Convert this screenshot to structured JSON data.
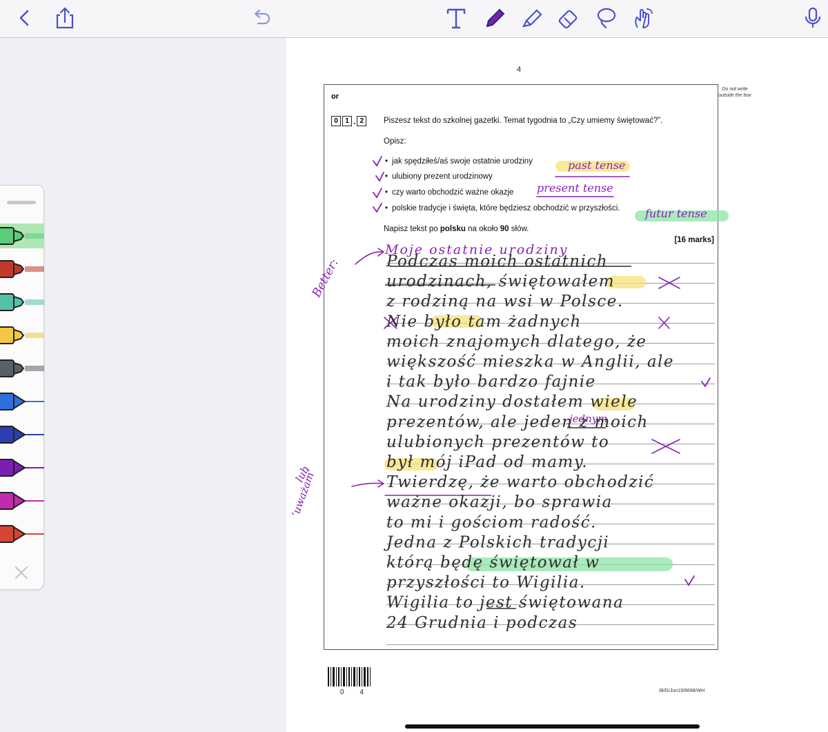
{
  "toolbar": {
    "back": "back-chevron-icon",
    "share": "share-icon",
    "undo": "undo-icon",
    "tools": [
      "text-tool-icon",
      "pen-tool-icon",
      "highlighter-tool-icon",
      "eraser-tool-icon",
      "lasso-tool-icon",
      "hand-touch-icon"
    ],
    "mic": "microphone-icon",
    "accent_color": "#4a4fd1"
  },
  "palette": {
    "selected_index": 0,
    "highlighters": [
      {
        "color": "#5ccb7a",
        "style": "highlighter",
        "selected": true
      },
      {
        "color": "#c0392b",
        "style": "highlighter"
      },
      {
        "color": "#55c0a8",
        "style": "highlighter"
      },
      {
        "color": "#f2c744",
        "style": "highlighter"
      },
      {
        "color": "#5b6066",
        "style": "highlighter"
      },
      {
        "color": "#2f6fdc",
        "style": "pen"
      },
      {
        "color": "#2b3fb0",
        "style": "pen"
      },
      {
        "color": "#7a1fb0",
        "style": "pen"
      },
      {
        "color": "#c22bb0",
        "style": "pen"
      },
      {
        "color": "#d64530",
        "style": "pen"
      }
    ]
  },
  "page": {
    "page_number": "4",
    "margin_note": "Do not write outside the box",
    "or_label": "or",
    "question_number": [
      "0",
      "1",
      "2"
    ],
    "question_text": "Piszesz tekst do szkolnej gazetki.  Temat tygodnia to „Czy umiemy świętować?”.",
    "opisz": "Opisz:",
    "bullets": [
      "jak spędziłeś/aś swoje ostatnie urodziny",
      "ulubiony prezent urodzinowy",
      "czy warto obchodzić ważne okazje",
      "polskie tradycje i święta, które będziesz obchodzić w przyszłości."
    ],
    "instruction_pre": "Napisz tekst po ",
    "instruction_bold1": "polsku",
    "instruction_mid": " na około ",
    "instruction_bold2": "90",
    "instruction_post": " słów.",
    "marks": "[16 marks]",
    "footer_code": "IB/G/Jun19/8688/WH",
    "barcode_digits": "0 4"
  },
  "annotations": {
    "past_tense": "past tense",
    "present_tense": "present tense",
    "future_tense": "futur tense",
    "better": "Better:",
    "correction_line1": "Moje ostatnie urodziny",
    "jednym": "jednym",
    "lub": "lub",
    "uwazam": "‘uważam’",
    "ink_color": "#8a22b5",
    "highlight_yellow": "#f7e27a",
    "highlight_green": "#8ee3a6"
  },
  "student_text": [
    "Podczas moich ostatnich",
    "urodzinach, świętowałem",
    "z rodziną na wsi w Polsce.",
    "Nie było tam żadnych",
    "moich znajomych dlatego, że",
    "większość mieszka w Anglii, ale",
    "i tak było bardzo fajnie",
    "Na urodziny dostałem wiele",
    "prezentów, ale jeden z moich",
    "ulubionych prezentów to",
    "był mój iPad od mamy.",
    "Twierdzę, że warto obchodzić",
    "ważne okazji, bo sprawia",
    "to mi i gościom radość.",
    "Jedna z Polskich tradycji",
    "którą będę świętował w",
    "przyszłości to Wigilia.",
    "Wigilia to jest świętowana",
    "24 Grudnia i podczas"
  ]
}
